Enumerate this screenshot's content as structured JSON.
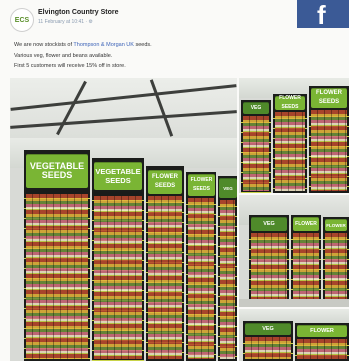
{
  "post": {
    "page_name": "Elvington Country Store",
    "timestamp": "11 February at 10:41 · ⚙",
    "avatar_text": "ECS",
    "lines": {
      "line1_prefix": "We are now stockists of ",
      "line1_link": "Thompson & Morgan UK",
      "line1_suffix": " seeds.",
      "line2": "Various veg, flower and beans available.",
      "line3": "First 5 customers will receive 15% off in store."
    }
  },
  "corner_logo": "f",
  "photos": {
    "main": {
      "signs": [
        "VEGETABLE SEEDS",
        "VEGETABLE SEEDS",
        "FLOWER SEEDS",
        "FLOWER SEEDS",
        "VEG"
      ]
    },
    "top_right": {
      "signs": [
        "VEG",
        "FLOWER SEEDS",
        "FLOWER SEEDS"
      ]
    },
    "middle_right": {
      "signs": [
        "VEG",
        "FLOWER",
        "FLOWER"
      ]
    },
    "bottom_right": {
      "signs": [
        "VEG",
        "FLOWER"
      ]
    }
  },
  "colors": {
    "sign_green": "#7ab534",
    "link_blue": "#3c63b8",
    "facebook_blue": "#3b5a96"
  }
}
